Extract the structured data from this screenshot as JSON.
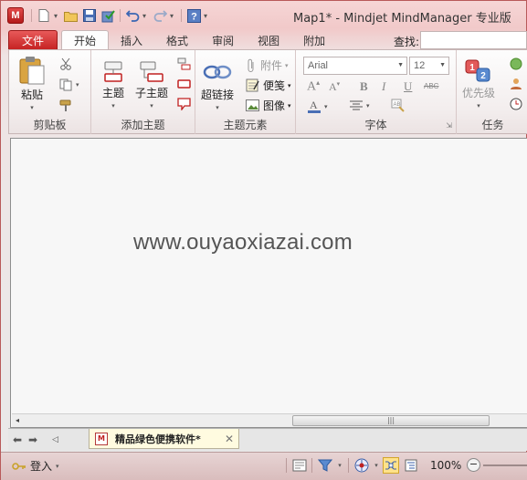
{
  "window": {
    "title": "Map1* - Mindjet MindManager 专业版",
    "logo": "M"
  },
  "qat": {
    "icons": [
      "new-doc-icon",
      "open-folder-icon",
      "save-icon",
      "check-save-icon",
      "undo-icon",
      "redo-icon",
      "help-icon"
    ]
  },
  "tabs": [
    {
      "label": "文件"
    },
    {
      "label": "开始"
    },
    {
      "label": "插入"
    },
    {
      "label": "格式"
    },
    {
      "label": "审阅"
    },
    {
      "label": "视图"
    },
    {
      "label": "附加"
    }
  ],
  "find": {
    "label": "查找:",
    "value": ""
  },
  "ribbon": {
    "clipboard": {
      "label": "剪贴板",
      "paste": "粘贴"
    },
    "add_topic": {
      "label": "添加主题",
      "topic": "主题",
      "subtopic": "子主题"
    },
    "topic_elements": {
      "label": "主题元素",
      "hyperlink": "超链接",
      "attachment": "附件",
      "notes": "便笺",
      "image": "图像"
    },
    "font": {
      "label": "字体",
      "font_name": "Arial",
      "font_size": "12",
      "bold": "B",
      "italic": "I",
      "underline": "U",
      "strike": "ABC"
    },
    "tasks": {
      "label": "任务",
      "priority": "优先级"
    }
  },
  "canvas": {
    "watermark": "www.ouyaoxiazai.com"
  },
  "doc_tab": {
    "label": "精品绿色便携软件*",
    "icon": "M"
  },
  "status": {
    "login": "登入",
    "zoom": "100%"
  },
  "colors": {
    "accent": "#c42020",
    "frame": "#f1c9c9"
  }
}
